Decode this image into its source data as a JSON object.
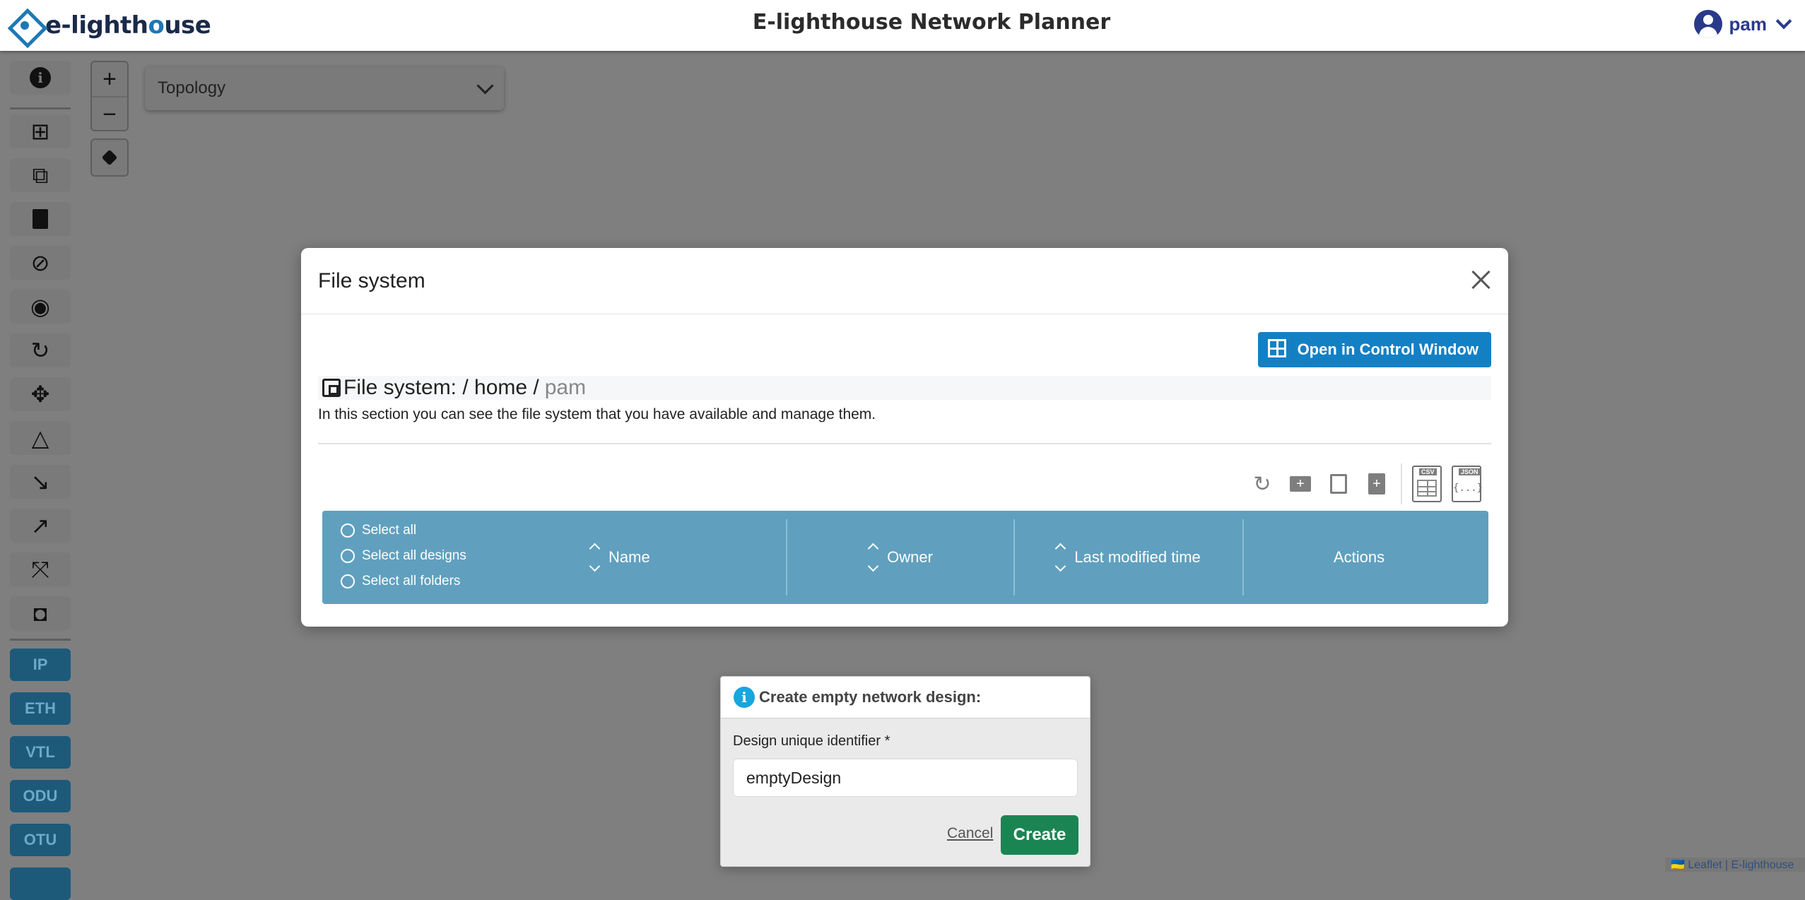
{
  "header": {
    "logo_text_prefix": "e-lighth",
    "logo_text_o": "o",
    "logo_text_suffix": "use",
    "title": "E-lighthouse Network Planner",
    "user": "pam"
  },
  "sidebar": {
    "icons": [
      "info-icon",
      "layout-icon",
      "layers-icon",
      "book-icon",
      "hide-layers-icon",
      "eye-icon",
      "refresh-icon",
      "network-icon",
      "triangle-icon",
      "trend-down-icon",
      "trend-up-icon",
      "collapse-icon",
      "camera-icon"
    ],
    "tags": [
      "IP",
      "ETH",
      "VTL",
      "ODU",
      "OTU"
    ]
  },
  "map": {
    "zoom_in": "+",
    "zoom_out": "−",
    "topology_label": "Topology",
    "attribution": "🇺🇦 Leaflet | E-lighthouse"
  },
  "file_modal": {
    "title": "File system",
    "open_control_label": "Open in Control Window",
    "breadcrumb_prefix": "File system: / home /",
    "breadcrumb_current": "pam",
    "description": "In this section you can see the file system that you have available and manage them.",
    "export_csv_tag": "CSV",
    "export_json_tag": "JSON",
    "export_json_brace": "{...}",
    "table": {
      "select_all": "Select all",
      "select_all_designs": "Select all designs",
      "select_all_folders": "Select all folders",
      "col_name": "Name",
      "col_owner": "Owner",
      "col_modified": "Last modified time",
      "col_actions": "Actions"
    }
  },
  "create_dialog": {
    "title": "Create empty network design:",
    "field_label": "Design unique identifier *",
    "field_value": "emptyDesign",
    "cancel_label": "Cancel",
    "create_label": "Create"
  },
  "colors": {
    "accent": "#1480c4",
    "table_header": "#60a0be",
    "create_button": "#1a8553",
    "info": "#17a6dd"
  }
}
